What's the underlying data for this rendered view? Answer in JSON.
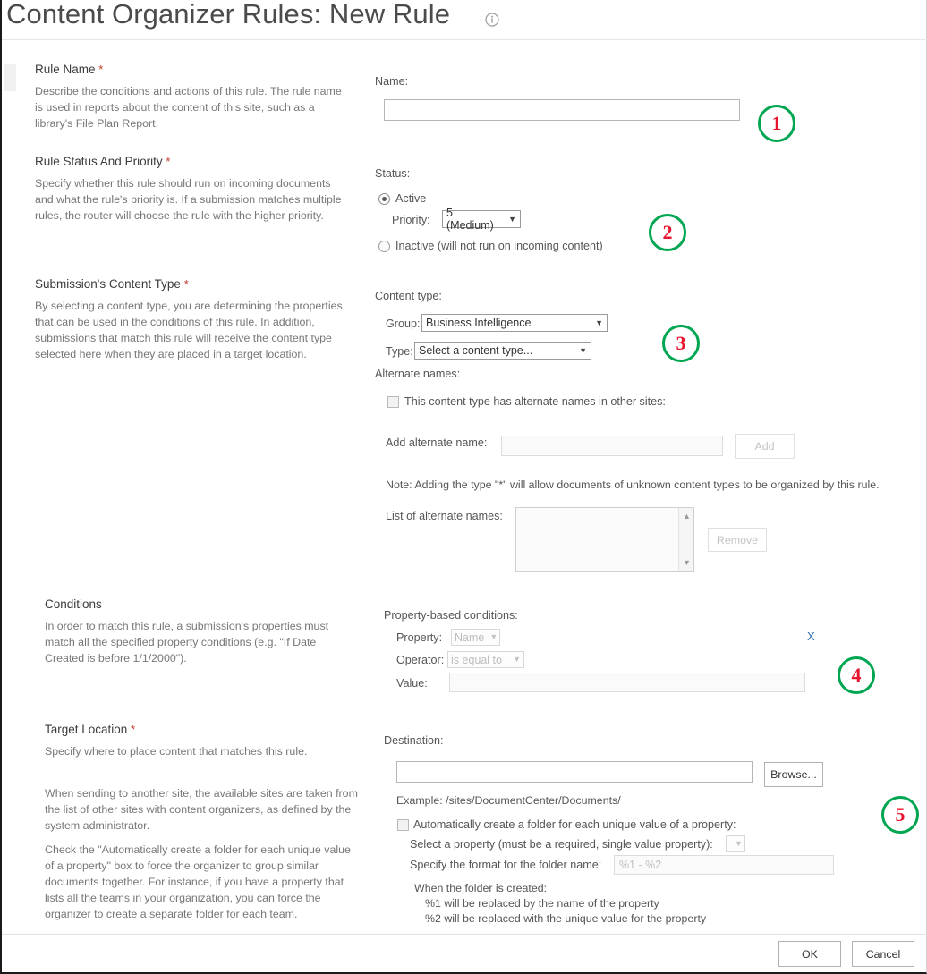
{
  "page": {
    "title": "Content Organizer Rules: New Rule",
    "info_icon": "info-icon"
  },
  "sections": [
    {
      "heading": "Rule Name",
      "required": "*",
      "description": "Describe the conditions and actions of this rule. The rule name is used in reports about the content of this site, such as a library's File Plan Report."
    },
    {
      "heading": "Rule Status And Priority",
      "required": "*",
      "description": "Specify whether this rule should run on incoming documents and what the rule's priority is. If a submission matches multiple rules, the router will choose the rule with the higher priority."
    },
    {
      "heading": "Submission's Content Type",
      "required": "*",
      "description": "By selecting a content type, you are determining the properties that can be used in the conditions of this rule. In addition, submissions that match this rule will receive the content type selected here when they are placed in a target location."
    },
    {
      "heading": "Conditions",
      "required": "",
      "description": "In order to match this rule, a submission's properties must match all the specified property conditions (e.g. \"If Date Created is before 1/1/2000\")."
    },
    {
      "heading": "Target Location",
      "required": "*",
      "description": "Specify where to place content that matches this rule.",
      "description2": "When sending to another site, the available sites are taken from the list of other sites with content organizers, as defined by the system administrator.",
      "description3": "Check the \"Automatically create a folder for each unique value of a property\" box to force the organizer to group similar documents together. For instance, if you have a property that lists all the teams in your organization, you can force the organizer to create a separate folder for each team."
    }
  ],
  "rule_name": {
    "label": "Name:",
    "value": "",
    "placeholder": ""
  },
  "status": {
    "label": "Status:",
    "active_label": "Active",
    "active_selected": true,
    "priority_label": "Priority:",
    "priority_value": "5 (Medium)",
    "inactive_label": "Inactive (will not run on incoming content)",
    "inactive_selected": false
  },
  "content_type": {
    "label": "Content type:",
    "group_label": "Group:",
    "group_value": "Business Intelligence",
    "type_label": "Type:",
    "type_value": "Select a content type...",
    "alternate_names_label": "Alternate names:",
    "alt_checkbox_label": "This content type has alternate names in other sites:",
    "alt_checkbox_checked": false,
    "add_alt_label": "Add alternate name:",
    "add_alt_value": "",
    "add_button": "Add",
    "note": "Note: Adding the type \"*\" will allow documents of unknown content types to be organized by this rule.",
    "list_label": "List of alternate names:",
    "list_items": [],
    "remove_button": "Remove"
  },
  "conditions": {
    "label": "Property-based conditions:",
    "property_label": "Property:",
    "property_value": "Name",
    "operator_label": "Operator:",
    "operator_value": "is equal to",
    "value_label": "Value:",
    "value_value": "",
    "remove_link": "X"
  },
  "target": {
    "destination_label": "Destination:",
    "destination_value": "",
    "browse_button": "Browse...",
    "example": "Example: /sites/DocumentCenter/Documents/",
    "auto_folder_label": "Automatically create a folder for each unique value of a property:",
    "auto_folder_checked": false,
    "select_property_label": "Select a property (must be a required, single value property):",
    "select_property_value": "",
    "format_label": "Specify the format for the folder name:",
    "format_placeholder": "%1 - %2",
    "format_value": "",
    "when_created": "When the folder is created:",
    "token1": "%1 will be replaced by the name of the property",
    "token2": "%2 will be replaced with the unique value for the property"
  },
  "footer": {
    "ok_label": "OK",
    "cancel_label": "Cancel"
  },
  "annotations": [
    {
      "number": "1"
    },
    {
      "number": "2"
    },
    {
      "number": "3"
    },
    {
      "number": "4"
    },
    {
      "number": "5"
    }
  ],
  "colors": {
    "badge_ring": "#00a651",
    "badge_number": "#e8142d",
    "required_star": "#c0392b",
    "link": "#2a6fb5"
  }
}
